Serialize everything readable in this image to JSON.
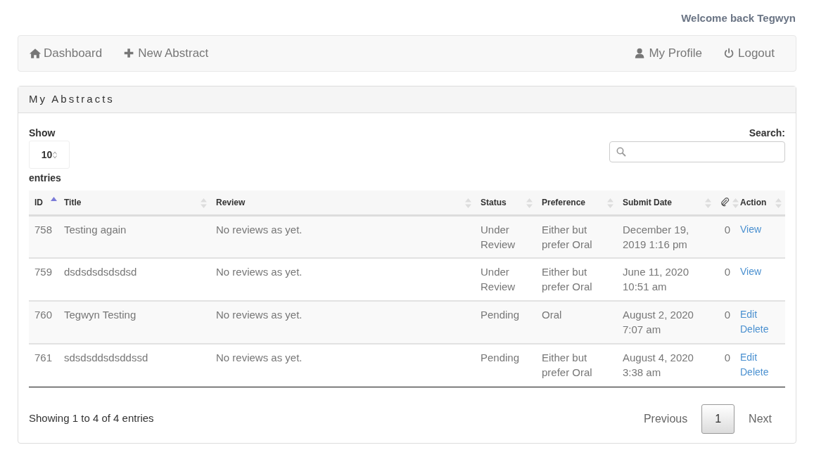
{
  "welcome": "Welcome back Tegwyn",
  "nav_left": [
    {
      "label": "Dashboard"
    },
    {
      "label": "New Abstract"
    }
  ],
  "nav_right": [
    {
      "label": "My Profile"
    },
    {
      "label": "Logout"
    }
  ],
  "panel_title": "My Abstracts",
  "length": {
    "label_before": "Show",
    "value": "10",
    "label_after": "entries"
  },
  "search": {
    "label": "Search:"
  },
  "table": {
    "columns": [
      {
        "label": "ID",
        "kind": "text",
        "sorted": true
      },
      {
        "label": "Title",
        "kind": "text",
        "sorted": false
      },
      {
        "label": "Review",
        "kind": "text",
        "sorted": false
      },
      {
        "label": "Status",
        "kind": "text",
        "sorted": false
      },
      {
        "label": "Preference",
        "kind": "text",
        "sorted": false
      },
      {
        "label": "Submit Date",
        "kind": "text",
        "sorted": false
      },
      {
        "kind": "paperclip",
        "sorted": false
      },
      {
        "label": "Action",
        "kind": "text",
        "sorted": false
      }
    ],
    "rows": [
      {
        "id": "758",
        "title": "Testing again",
        "review": "No reviews as yet.",
        "status": "Under Review",
        "preference": "Either but prefer Oral",
        "submit_date": "December 19, 2019 1:16 pm",
        "attachments": "0",
        "actions": [
          "View"
        ]
      },
      {
        "id": "759",
        "title": "dsdsdsdsdsdsd",
        "review": "No reviews as yet.",
        "status": "Under Review",
        "preference": "Either but prefer Oral",
        "submit_date": "June 11, 2020 10:51 am",
        "attachments": "0",
        "actions": [
          "View"
        ]
      },
      {
        "id": "760",
        "title": "Tegwyn Testing",
        "review": "No reviews as yet.",
        "status": "Pending",
        "preference": "Oral",
        "submit_date": "August 2, 2020 7:07 am",
        "attachments": "0",
        "actions": [
          "Edit",
          "Delete"
        ]
      },
      {
        "id": "761",
        "title": "sdsdsddsdsddssd",
        "review": "No reviews as yet.",
        "status": "Pending",
        "preference": "Either but prefer Oral",
        "submit_date": "August 4, 2020 3:38 am",
        "attachments": "0",
        "actions": [
          "Edit",
          "Delete"
        ]
      }
    ]
  },
  "info": "Showing 1 to 4 of 4 entries",
  "pagination": [
    {
      "label": "Previous",
      "selected": false
    },
    {
      "label": "1",
      "selected": true
    },
    {
      "label": "Next",
      "selected": false
    }
  ]
}
